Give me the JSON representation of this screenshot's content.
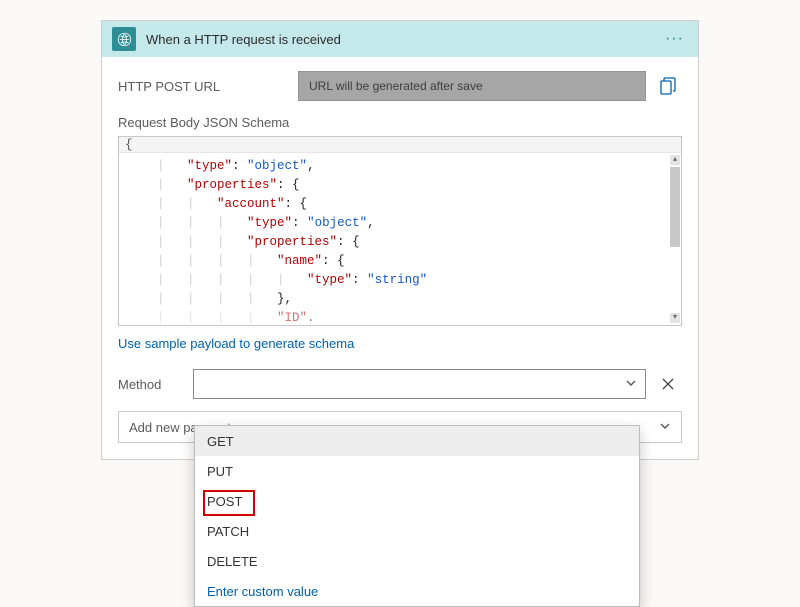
{
  "title": "When a HTTP request is received",
  "urlRow": {
    "label": "HTTP POST URL",
    "value": "URL will be generated after save"
  },
  "schemaLabel": "Request Body JSON Schema",
  "schemaHeader": "{",
  "schemaLines": [
    {
      "indent": 0,
      "key": "\"type\"",
      "sep": ": ",
      "val": "\"object\"",
      "tail": ","
    },
    {
      "indent": 0,
      "key": "\"properties\"",
      "sep": ": ",
      "val": "",
      "tail": "{"
    },
    {
      "indent": 1,
      "key": "\"account\"",
      "sep": ": ",
      "val": "",
      "tail": "{"
    },
    {
      "indent": 2,
      "key": "\"type\"",
      "sep": ": ",
      "val": "\"object\"",
      "tail": ","
    },
    {
      "indent": 2,
      "key": "\"properties\"",
      "sep": ": ",
      "val": "",
      "tail": "{"
    },
    {
      "indent": 3,
      "key": "\"name\"",
      "sep": ": ",
      "val": "",
      "tail": "{"
    },
    {
      "indent": 4,
      "key": "\"type\"",
      "sep": ": ",
      "val": "\"string\"",
      "tail": ""
    },
    {
      "indent": 3,
      "key": "",
      "sep": "",
      "val": "",
      "tail": "},"
    },
    {
      "indent": 3,
      "key": "\"ID\"",
      "sep": "",
      "val": "",
      "tail": ". ",
      "cut": true
    }
  ],
  "sampleLink": "Use sample payload to generate schema",
  "methodLabel": "Method",
  "addParam": "Add new parameter",
  "dropdown": {
    "items": [
      {
        "label": "GET",
        "hover": true
      },
      {
        "label": "PUT"
      },
      {
        "label": "POST",
        "highlight": true
      },
      {
        "label": "PATCH"
      },
      {
        "label": "DELETE"
      }
    ],
    "custom": "Enter custom value"
  }
}
